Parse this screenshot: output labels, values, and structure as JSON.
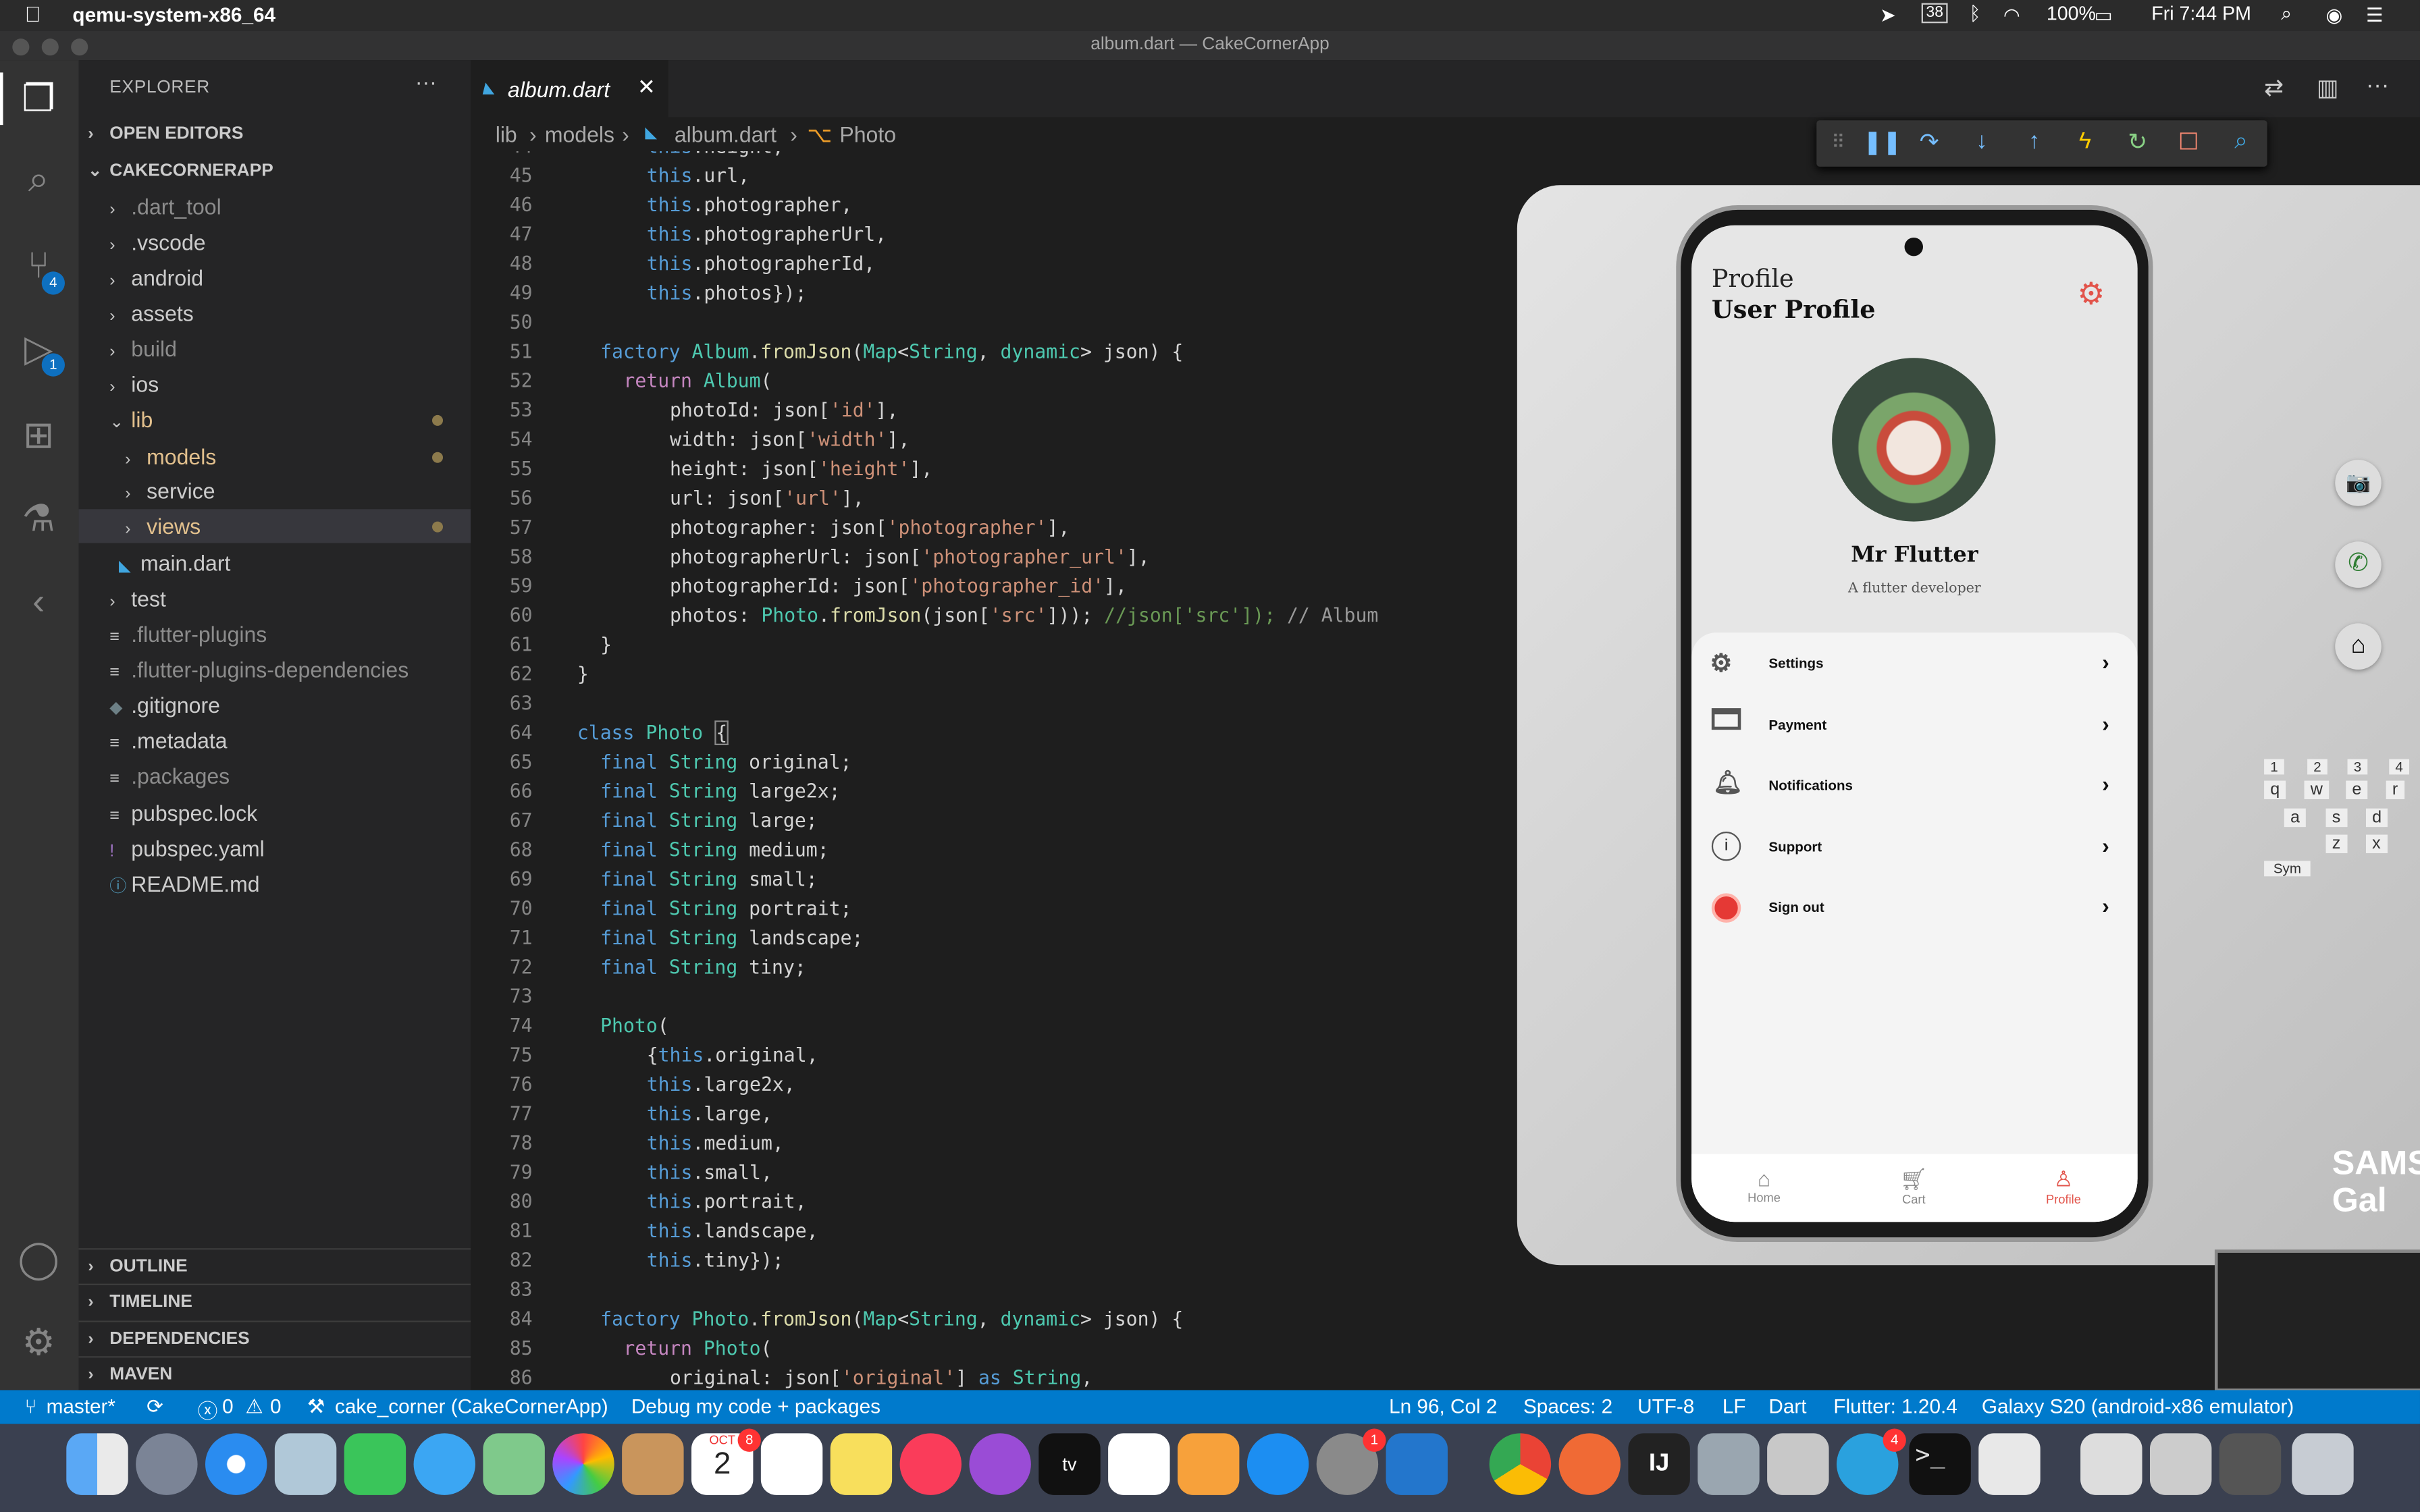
{
  "menubar": {
    "app_name": "qemu-system-x86_64",
    "battery": "100%",
    "clock": "Fri 7:44 PM"
  },
  "window": {
    "title": "album.dart — CakeCornerApp"
  },
  "activity": {
    "scm_badge": "4",
    "debug_badge": "1"
  },
  "explorer": {
    "title": "EXPLORER",
    "open_editors": "OPEN EDITORS",
    "project": "CAKECORNERAPP",
    "items": [
      ".dart_tool",
      ".vscode",
      "android",
      "assets",
      "build",
      "ios",
      "lib",
      "models",
      "service",
      "views",
      "main.dart",
      "test",
      ".flutter-plugins",
      ".flutter-plugins-dependencies",
      ".gitignore",
      ".metadata",
      ".packages",
      "pubspec.lock",
      "pubspec.yaml",
      "README.md"
    ],
    "sections": [
      "OUTLINE",
      "TIMELINE",
      "DEPENDENCIES",
      "MAVEN"
    ]
  },
  "editor": {
    "tab": "album.dart",
    "breadcrumb": [
      "lib",
      "models",
      "album.dart",
      "Photo"
    ],
    "line_start": 44
  },
  "emulator": {
    "header_small": "Profile",
    "header_title": "User Profile",
    "user_name": "Mr Flutter",
    "user_role": "A flutter developer",
    "menu": [
      "Settings",
      "Payment",
      "Notifications",
      "Support",
      "Sign out"
    ],
    "nav": [
      "Home",
      "Cart",
      "Profile"
    ],
    "brand": "SAMS Gal",
    "keys": [
      "1",
      "2",
      "3",
      "4",
      "q",
      "w",
      "e",
      "r",
      "a",
      "s",
      "d",
      "z",
      "x",
      "Sym"
    ]
  },
  "statusbar": {
    "branch": "master*",
    "errors": "0",
    "warnings": "0",
    "project": "cake_corner (CakeCornerApp)",
    "debug": "Debug my code + packages",
    "position": "Ln 96, Col 2",
    "spaces": "Spaces: 2",
    "encoding": "UTF-8",
    "eol": "LF",
    "language": "Dart",
    "flutter": "Flutter: 1.20.4",
    "device": "Galaxy S20 (android-x86 emulator)"
  },
  "dock": {
    "calendar_month": "OCT",
    "calendar_day": "2",
    "calendar_badge": "8",
    "prefs_badge": "1",
    "telegram_badge": "4"
  },
  "colors": {
    "accent": "#007acc",
    "danger": "#e53935",
    "profile_accent": "#e2544b"
  }
}
